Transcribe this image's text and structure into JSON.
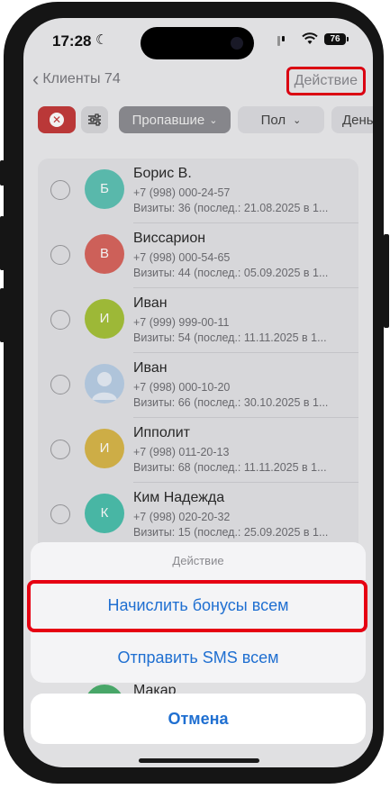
{
  "status": {
    "time": "17:28",
    "battery": "76"
  },
  "nav": {
    "back_label": "Клиенты 74",
    "action_label": "Действие"
  },
  "filters": {
    "missing_label": "Пропавшие",
    "gender_label": "Пол",
    "day_label": "День"
  },
  "clients": [
    {
      "initial": "Б",
      "color": "#5ec2b5",
      "name": "Борис В.",
      "phone": "+7 (998) 000-24-57",
      "visits": "Визиты: 36 (послед.: 21.08.2025 в 1..."
    },
    {
      "initial": "В",
      "color": "#d9665e",
      "name": "Виссарион",
      "phone": "+7 (998) 000-54-65",
      "visits": "Визиты: 44 (послед.: 05.09.2025 в 1..."
    },
    {
      "initial": "И",
      "color": "#a6c23a",
      "name": "Иван",
      "phone": "+7 (999) 999-00-11",
      "visits": "Визиты: 54 (послед.: 11.11.2025 в 1..."
    },
    {
      "initial": "",
      "color": "#b9cfe6",
      "name": "Иван",
      "phone": "+7 (998) 000-10-20",
      "visits": "Визиты: 66 (послед.: 30.10.2025 в 1..."
    },
    {
      "initial": "И",
      "color": "#d9b74a",
      "name": "Ипполит",
      "phone": "+7 (998) 011-20-13",
      "visits": "Визиты: 68 (послед.: 11.11.2025 в 1..."
    },
    {
      "initial": "К",
      "color": "#4cc0ad",
      "name": "Ким Надежда",
      "phone": "+7 (998) 020-20-32",
      "visits": "Визиты: 15 (послед.: 25.09.2025 в 1..."
    }
  ],
  "peek_name": "Макар",
  "sheet": {
    "title": "Действие",
    "item1": "Начислить бонусы всем",
    "item2": "Отправить SMS всем",
    "cancel": "Отмена"
  }
}
